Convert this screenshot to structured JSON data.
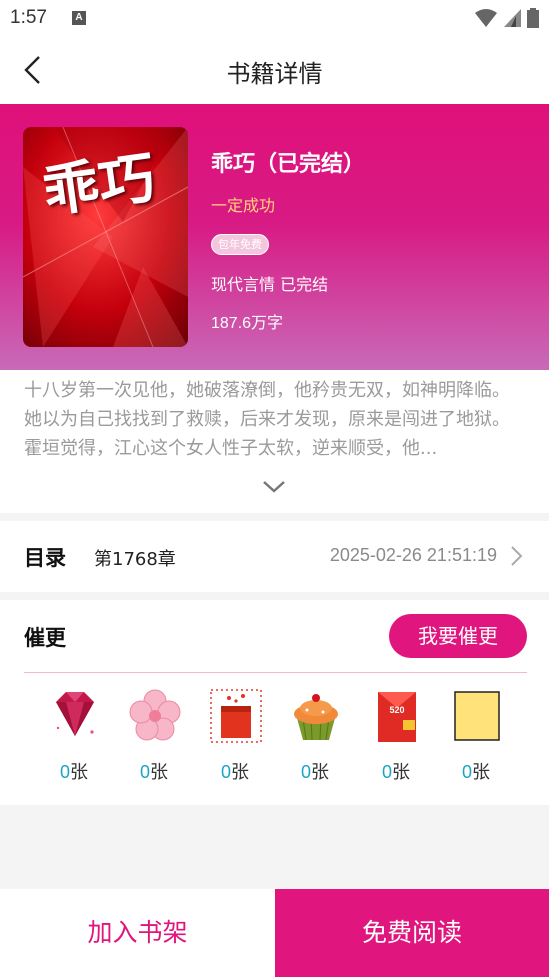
{
  "status_bar": {
    "time": "1:57",
    "notification_letter": "A"
  },
  "nav": {
    "title": "书籍详情"
  },
  "book": {
    "title": "乖巧（已完结）",
    "author": "一定成功",
    "badge": "包年免费",
    "genre": "现代言情 已完结",
    "word_count": "187.6万字",
    "cover_text": "乖巧",
    "description": "十八岁第一次见他，她破落潦倒，他矜贵无双，如神明降临。她以为自己找找到了救赎，后来才发现，原来是闯进了地狱。霍垣觉得，江心这个女人性子太软，逆来顺受，他..."
  },
  "catalog": {
    "label": "目录",
    "chapter": "第1768章",
    "updated": "2025-02-26 21:51:19"
  },
  "urge": {
    "title": "催更",
    "button": "我要催更",
    "gifts": [
      {
        "icon": "diamond-icon",
        "count": "0",
        "unit": "张"
      },
      {
        "icon": "flower-icon",
        "count": "0",
        "unit": "张"
      },
      {
        "icon": "gift-box-icon",
        "count": "0",
        "unit": "张"
      },
      {
        "icon": "cupcake-icon",
        "count": "0",
        "unit": "张"
      },
      {
        "icon": "red-envelope-icon",
        "count": "0",
        "unit": "张",
        "label": "520"
      },
      {
        "icon": "yellow-card-icon",
        "count": "0",
        "unit": "张"
      }
    ]
  },
  "bottom": {
    "add_shelf": "加入书架",
    "read": "免费阅读"
  },
  "colors": {
    "accent": "#e0157d",
    "author": "#ffd27a",
    "count": "#1aa5c8"
  }
}
